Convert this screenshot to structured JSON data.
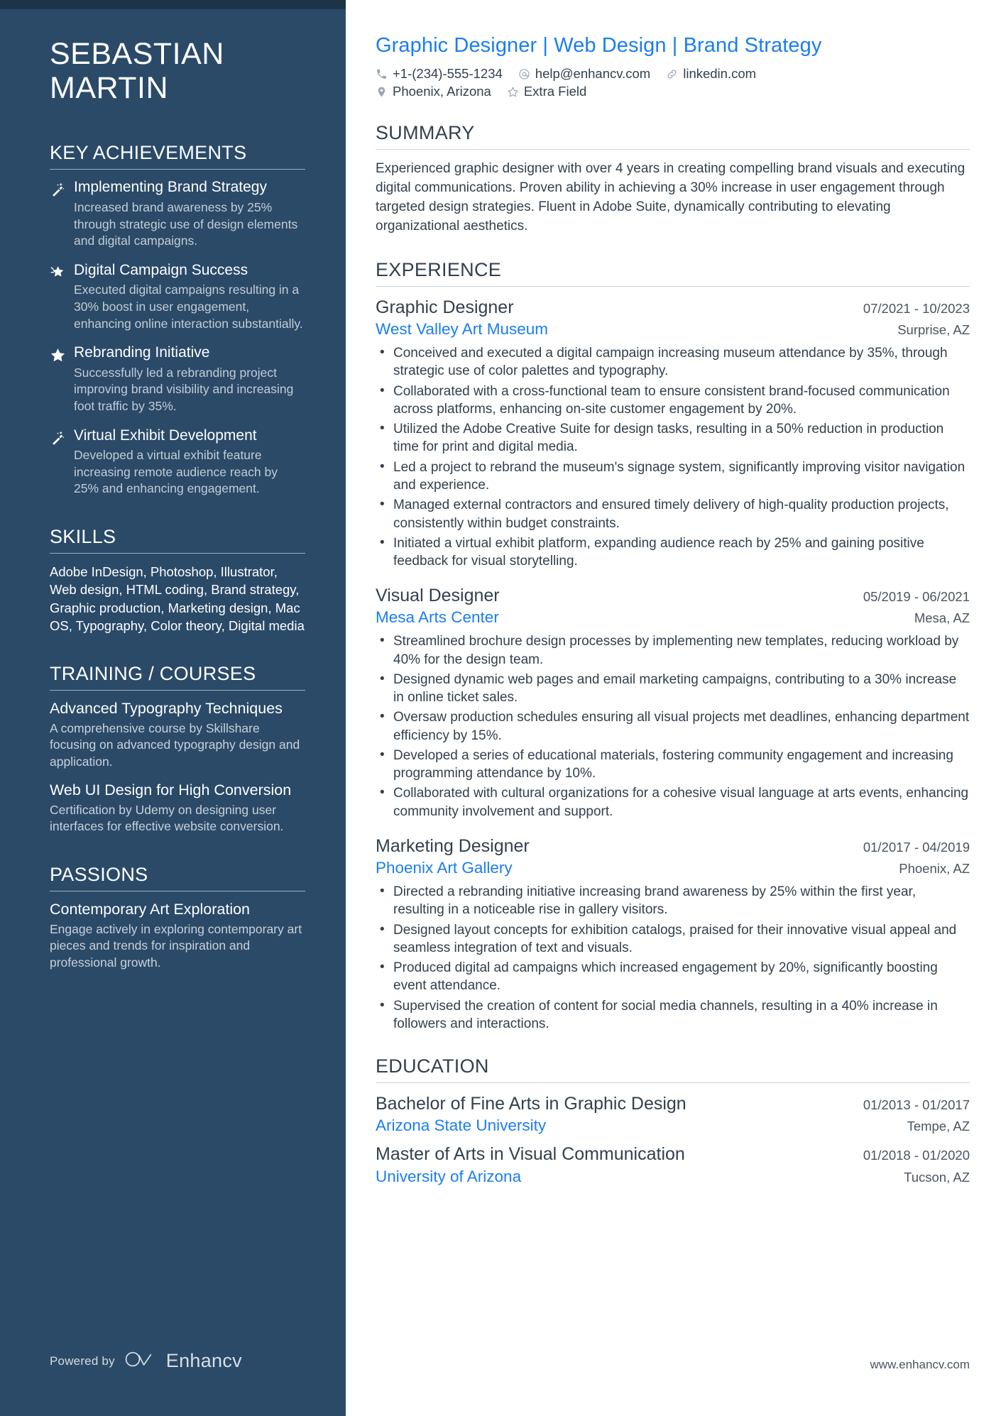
{
  "sidebar": {
    "name_line1": "SEBASTIAN",
    "name_line2": "MARTIN",
    "achievements_heading": "KEY ACHIEVEMENTS",
    "achievements": [
      {
        "icon": "magic-wand-icon",
        "title": "Implementing Brand Strategy",
        "desc": "Increased brand awareness by 25% through strategic use of design elements and digital campaigns."
      },
      {
        "icon": "shooting-star-icon",
        "title": "Digital Campaign Success",
        "desc": "Executed digital campaigns resulting in a 30% boost in user engagement, enhancing online interaction substantially."
      },
      {
        "icon": "star-icon",
        "title": "Rebranding Initiative",
        "desc": "Successfully led a rebranding project improving brand visibility and increasing foot traffic by 35%."
      },
      {
        "icon": "magic-wand-icon",
        "title": "Virtual Exhibit Development",
        "desc": "Developed a virtual exhibit feature increasing remote audience reach by 25% and enhancing engagement."
      }
    ],
    "skills_heading": "SKILLS",
    "skills_text": "Adobe InDesign, Photoshop, Illustrator, Web design, HTML coding, Brand strategy, Graphic production, Marketing design, Mac OS, Typography, Color theory, Digital media",
    "training_heading": "TRAINING / COURSES",
    "courses": [
      {
        "title": "Advanced Typography Techniques",
        "desc": "A comprehensive course by Skillshare focusing on advanced typography design and application."
      },
      {
        "title": "Web UI Design for High Conversion",
        "desc": "Certification by Udemy on designing user interfaces for effective website conversion."
      }
    ],
    "passions_heading": "PASSIONS",
    "passions": [
      {
        "title": "Contemporary Art Exploration",
        "desc": "Engage actively in exploring contemporary art pieces and trends for inspiration and professional growth."
      }
    ],
    "powered_by_label": "Powered by",
    "brand_name": "Enhancv"
  },
  "main": {
    "headline": "Graphic Designer | Web Design | Brand Strategy",
    "contacts": [
      {
        "icon": "phone-icon",
        "text": "+1-(234)-555-1234"
      },
      {
        "icon": "email-icon",
        "text": "help@enhancv.com"
      },
      {
        "icon": "link-icon",
        "text": "linkedin.com"
      }
    ],
    "contacts_row2": [
      {
        "icon": "location-pin-icon",
        "text": "Phoenix, Arizona"
      },
      {
        "icon": "star-outline-icon",
        "text": "Extra Field"
      }
    ],
    "summary_heading": "SUMMARY",
    "summary_text": "Experienced graphic designer with over 4 years in creating compelling brand visuals and executing digital communications. Proven ability in achieving a 30% increase in user engagement through targeted design strategies. Fluent in Adobe Suite, dynamically contributing to elevating organizational aesthetics.",
    "experience_heading": "EXPERIENCE",
    "jobs": [
      {
        "title": "Graphic Designer",
        "date": "07/2021 - 10/2023",
        "company": "West Valley Art Museum",
        "location": "Surprise, AZ",
        "bullets": [
          "Conceived and executed a digital campaign increasing museum attendance by 35%, through strategic use of color palettes and typography.",
          "Collaborated with a cross-functional team to ensure consistent brand-focused communication across platforms, enhancing on-site customer engagement by 20%.",
          "Utilized the Adobe Creative Suite for design tasks, resulting in a 50% reduction in production time for print and digital media.",
          "Led a project to rebrand the museum's signage system, significantly improving visitor navigation and experience.",
          "Managed external contractors and ensured timely delivery of high-quality production projects, consistently within budget constraints.",
          "Initiated a virtual exhibit platform, expanding audience reach by 25% and gaining positive feedback for visual storytelling."
        ]
      },
      {
        "title": "Visual Designer",
        "date": "05/2019 - 06/2021",
        "company": "Mesa Arts Center",
        "location": "Mesa, AZ",
        "bullets": [
          "Streamlined brochure design processes by implementing new templates, reducing workload by 40% for the design team.",
          "Designed dynamic web pages and email marketing campaigns, contributing to a 30% increase in online ticket sales.",
          "Oversaw production schedules ensuring all visual projects met deadlines, enhancing department efficiency by 15%.",
          "Developed a series of educational materials, fostering community engagement and increasing programming attendance by 10%.",
          "Collaborated with cultural organizations for a cohesive visual language at arts events, enhancing community involvement and support."
        ]
      },
      {
        "title": "Marketing Designer",
        "date": "01/2017 - 04/2019",
        "company": "Phoenix Art Gallery",
        "location": "Phoenix, AZ",
        "bullets": [
          "Directed a rebranding initiative increasing brand awareness by 25% within the first year, resulting in a noticeable rise in gallery visitors.",
          "Designed layout concepts for exhibition catalogs, praised for their innovative visual appeal and seamless integration of text and visuals.",
          "Produced digital ad campaigns which increased engagement by 20%, significantly boosting event attendance.",
          "Supervised the creation of content for social media channels, resulting in a 40% increase in followers and interactions."
        ]
      }
    ],
    "education_heading": "EDUCATION",
    "education": [
      {
        "title": "Bachelor of Fine Arts in Graphic Design",
        "date": "01/2013 - 01/2017",
        "school": "Arizona State University",
        "location": "Tempe, AZ"
      },
      {
        "title": "Master of Arts in Visual Communication",
        "date": "01/2018 - 01/2020",
        "school": "University of Arizona",
        "location": "Tucson, AZ"
      }
    ],
    "site_url": "www.enhancv.com"
  }
}
